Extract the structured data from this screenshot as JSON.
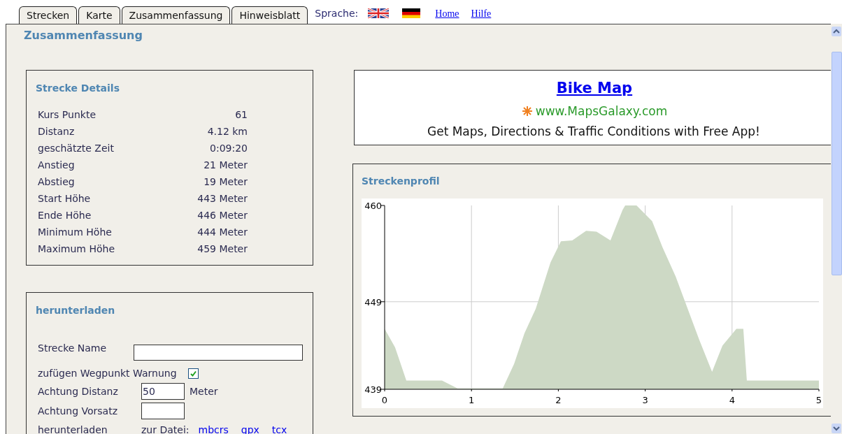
{
  "tabs": [
    {
      "label": "Strecken"
    },
    {
      "label": "Karte"
    },
    {
      "label": "Zusammenfassung"
    },
    {
      "label": "Hinweisblatt"
    }
  ],
  "language_label": "Sprache:",
  "links": [
    "Home",
    "Hilfe"
  ],
  "page_title": "Zusammenfassung",
  "details": {
    "title": "Strecke Details",
    "rows": [
      {
        "label": "Kurs Punkte",
        "value": "61"
      },
      {
        "label": "Distanz",
        "value": "4.12 km"
      },
      {
        "label": "geschätzte Zeit",
        "value": "0:09:20"
      },
      {
        "label": "Anstieg",
        "value": "21 Meter"
      },
      {
        "label": "Abstieg",
        "value": "19 Meter"
      },
      {
        "label": "Start Höhe",
        "value": "443 Meter"
      },
      {
        "label": "Ende Höhe",
        "value": "446 Meter"
      },
      {
        "label": "Minimum Höhe",
        "value": "444 Meter"
      },
      {
        "label": "Maximum Höhe",
        "value": "459 Meter"
      }
    ]
  },
  "download": {
    "title": "herunterladen",
    "name_label": "Strecke Name",
    "warning_label": "zufügen Wegpunkt Warnung",
    "warning_checked": true,
    "distance_label": "Achtung Distanz",
    "distance_value": "50",
    "distance_unit": "Meter",
    "prefix_label": "Achtung Vorsatz",
    "download_label": "herunterladen",
    "file_label": "zur Datei:",
    "formats": [
      "mbcrs",
      "gpx",
      "tcx"
    ]
  },
  "ad": {
    "title": "Bike Map",
    "url": "www.MapsGalaxy.com",
    "text": "Get Maps, Directions & Traffic Conditions with Free App!"
  },
  "profile": {
    "title": "Streckenprofil",
    "chart_data": {
      "type": "area",
      "x": [
        0,
        0.12,
        0.25,
        0.66,
        0.84,
        1.36,
        1.49,
        1.61,
        1.74,
        1.91,
        2.03,
        2.16,
        2.32,
        2.44,
        2.6,
        2.74,
        2.77,
        2.9,
        3.08,
        3.2,
        3.35,
        3.62,
        3.77,
        3.89,
        4.05,
        4.13,
        4.17,
        5
      ],
      "grid": true,
      "series": [
        {
          "color": "#cdd9c5",
          "values": [
            445.9,
            443.8,
            440,
            440,
            439.1,
            439.1,
            441.9,
            445.4,
            448.2,
            453.5,
            455.9,
            456,
            457.1,
            457,
            456,
            459.5,
            460,
            460,
            458.2,
            455.2,
            451.9,
            444.7,
            441,
            444,
            445.9,
            445.9,
            440,
            440
          ]
        }
      ],
      "xlim": [
        0,
        5
      ],
      "ylim": [
        439,
        460
      ],
      "xticks": [
        0,
        1,
        2,
        3,
        4,
        5
      ],
      "yticks": [
        439,
        449,
        460
      ]
    }
  }
}
